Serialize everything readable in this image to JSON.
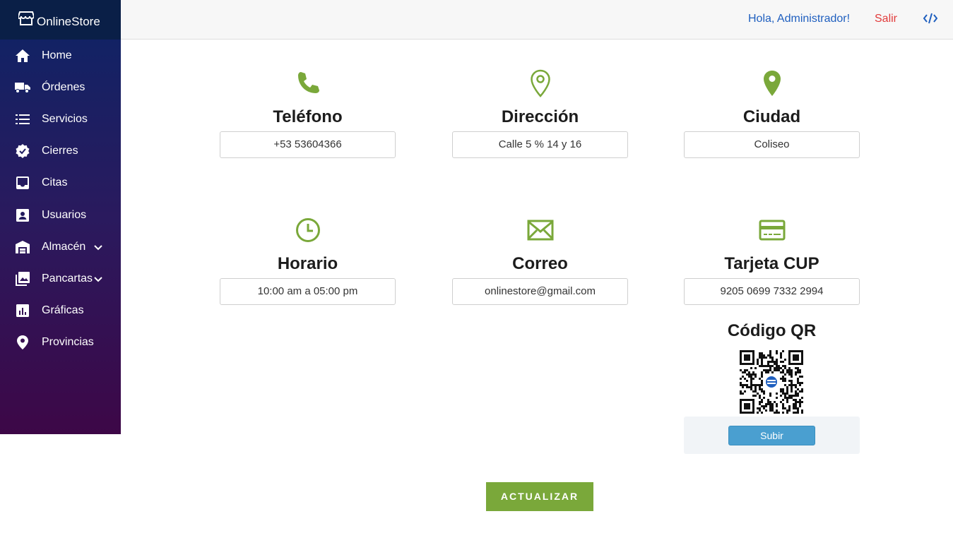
{
  "app": {
    "brand": "OnlineStore",
    "store_icon": "store-icon"
  },
  "sidebar": {
    "items": [
      {
        "label": "Home",
        "icon": "home-icon"
      },
      {
        "label": "Órdenes",
        "icon": "truck-icon"
      },
      {
        "label": "Servicios",
        "icon": "list-icon"
      },
      {
        "label": "Cierres",
        "icon": "verified-badge-icon"
      },
      {
        "label": "Citas",
        "icon": "inbox-icon"
      },
      {
        "label": "Usuarios",
        "icon": "user-card-icon"
      },
      {
        "label": "Almacén",
        "icon": "warehouse-icon",
        "expandable": true
      },
      {
        "label": "Pancartas",
        "icon": "image-gallery-icon",
        "expandable": true
      },
      {
        "label": "Gráficas",
        "icon": "bar-chart-icon"
      },
      {
        "label": "Provincias",
        "icon": "map-pin-icon"
      }
    ]
  },
  "header": {
    "greeting": "Hola, Administrador!",
    "logout": "Salir",
    "code_icon": "code-icon"
  },
  "contact": {
    "phone": {
      "title": "Teléfono",
      "value": "+53 53604366",
      "icon": "phone-icon"
    },
    "address": {
      "title": "Dirección",
      "value": "Calle 5 % 14 y 16",
      "icon": "location-outline-icon"
    },
    "city": {
      "title": "Ciudad",
      "value": "Coliseo",
      "icon": "location-filled-icon"
    },
    "schedule": {
      "title": "Horario",
      "value": "10:00 am a 05:00 pm",
      "icon": "clock-icon"
    },
    "email": {
      "title": "Correo",
      "value": "onlinestore@gmail.com",
      "icon": "envelope-icon"
    },
    "card": {
      "title": "Tarjeta CUP",
      "value": "9205 0699 7332 2994",
      "icon": "credit-card-icon"
    }
  },
  "qr": {
    "title": "Código QR",
    "upload_label": "Subir"
  },
  "actions": {
    "update_label": "ACTUALIZAR"
  },
  "colors": {
    "accent_green": "#7aa83a",
    "link_blue": "#1f5fbf",
    "logout_red": "#e23b3b",
    "upload_blue": "#4a9fd0"
  }
}
